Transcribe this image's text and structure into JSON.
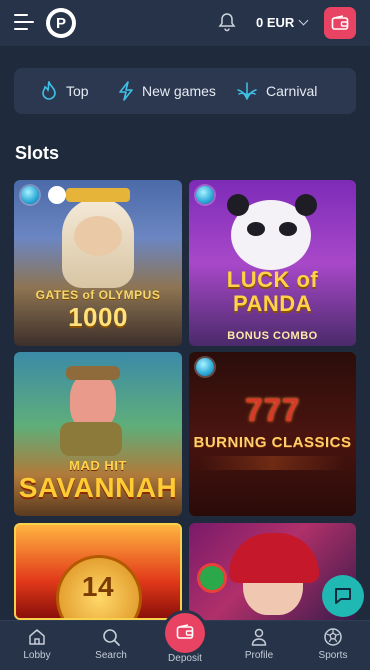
{
  "header": {
    "balance": "0 EUR",
    "icons": [
      "menu-icon",
      "logo",
      "bell-icon",
      "chevron-down-icon",
      "wallet-icon"
    ]
  },
  "categories": [
    {
      "label": "Top",
      "icon": "flame-icon"
    },
    {
      "label": "New games",
      "icon": "lightning-icon"
    },
    {
      "label": "Carnival",
      "icon": "leaf-icon"
    }
  ],
  "section": {
    "title": "Slots"
  },
  "games": [
    {
      "title_line1": "GATES of OLYMPUS",
      "title_line2": "1000"
    },
    {
      "title_line1": "LUCK of PANDA",
      "title_line2": "BONUS COMBO"
    },
    {
      "title_line1": "MAD HIT",
      "title_line2": "SAVANNAH"
    },
    {
      "title_line1": "777",
      "title_line2": "BURNING CLASSICS"
    },
    {
      "title_line1": "14",
      "title_line2": ""
    },
    {
      "title_line1": "",
      "title_line2": ""
    }
  ],
  "bottom_nav": [
    {
      "label": "Lobby",
      "icon": "home-icon"
    },
    {
      "label": "Search",
      "icon": "search-icon"
    },
    {
      "label": "Deposit",
      "icon": "wallet-icon"
    },
    {
      "label": "Profile",
      "icon": "user-icon"
    },
    {
      "label": "Sports",
      "icon": "soccer-ball-icon"
    }
  ],
  "colors": {
    "accent": "#e84362",
    "background": "#1f2b3d",
    "panel": "#263349",
    "chat": "#1fb8b2"
  }
}
